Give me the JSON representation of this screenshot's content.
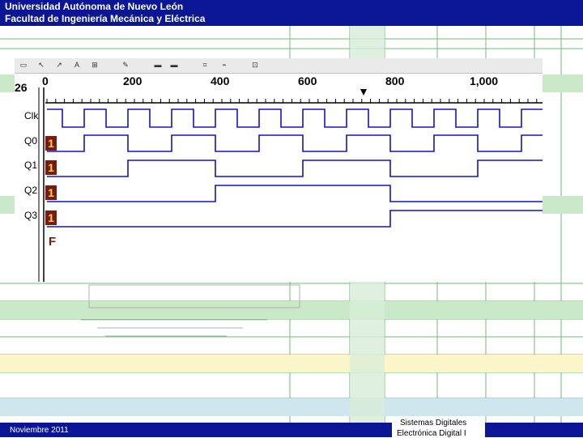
{
  "header": {
    "line1": "Universidad Autónoma de Nuevo León",
    "line2": "Facultad de Ingeniería Mecánica y Eléctrica"
  },
  "footer": {
    "date": "Noviembre 2011",
    "course1": "Sistemas Digitales",
    "course2": "Electrónica Digital I"
  },
  "simulator": {
    "timeline_partial": "26",
    "ticks": [
      "0",
      "200",
      "400",
      "600",
      "800",
      "1,000"
    ],
    "signals": [
      {
        "name": "Clk",
        "value": ""
      },
      {
        "name": "Q0",
        "value": "1"
      },
      {
        "name": "Q1",
        "value": "1"
      },
      {
        "name": "Q2",
        "value": "1"
      },
      {
        "name": "Q3",
        "value": "1"
      }
    ],
    "final_marker": "F",
    "wave_color": "#1212c8"
  }
}
